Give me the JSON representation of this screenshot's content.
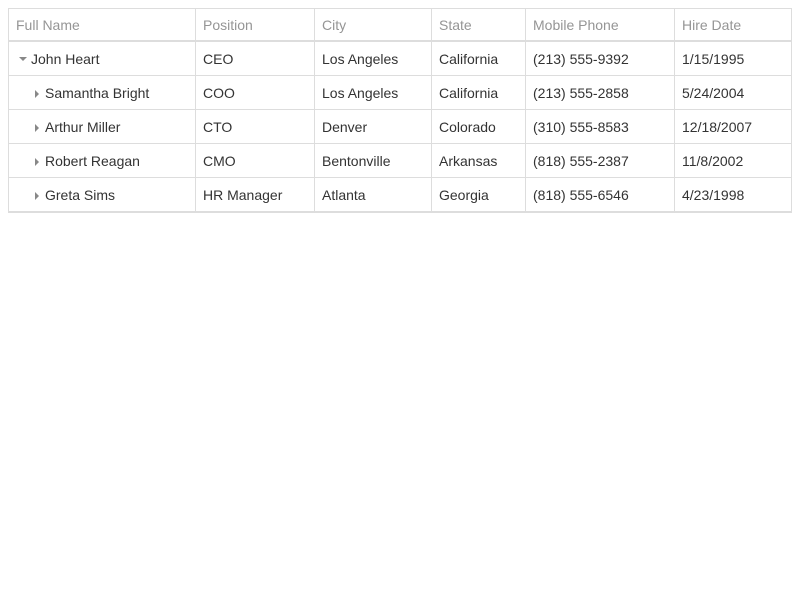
{
  "columns": {
    "full_name": "Full Name",
    "position": "Position",
    "city": "City",
    "state": "State",
    "mobile_phone": "Mobile Phone",
    "hire_date": "Hire Date"
  },
  "rows": [
    {
      "full_name": "John Heart",
      "position": "CEO",
      "city": "Los Angeles",
      "state": "California",
      "mobile_phone": "(213) 555-9392",
      "hire_date": "1/15/1995",
      "level": 0,
      "expanded": true
    },
    {
      "full_name": "Samantha Bright",
      "position": "COO",
      "city": "Los Angeles",
      "state": "California",
      "mobile_phone": "(213) 555-2858",
      "hire_date": "5/24/2004",
      "level": 1,
      "expanded": false
    },
    {
      "full_name": "Arthur Miller",
      "position": "CTO",
      "city": "Denver",
      "state": "Colorado",
      "mobile_phone": "(310) 555-8583",
      "hire_date": "12/18/2007",
      "level": 1,
      "expanded": false
    },
    {
      "full_name": "Robert Reagan",
      "position": "CMO",
      "city": "Bentonville",
      "state": "Arkansas",
      "mobile_phone": "(818) 555-2387",
      "hire_date": "11/8/2002",
      "level": 1,
      "expanded": false
    },
    {
      "full_name": "Greta Sims",
      "position": "HR Manager",
      "city": "Atlanta",
      "state": "Georgia",
      "mobile_phone": "(818) 555-6546",
      "hire_date": "4/23/1998",
      "level": 1,
      "expanded": false
    }
  ]
}
